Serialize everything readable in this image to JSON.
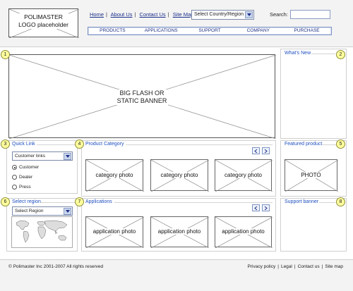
{
  "header": {
    "logo_text": "POLIMASTER\nLOGO  placeholder",
    "top_links": [
      "Home",
      "About Us",
      "Contact Us",
      "Site Map"
    ],
    "country_select": "Select Country/Region",
    "search_label": "Search:",
    "search_value": "",
    "nav": [
      "PRODUCTS",
      "APPLICATIONS",
      "SUPPORT",
      "COMPANY",
      "PURCHASE"
    ]
  },
  "banner": {
    "badge": "1",
    "label": "BIG FLASH OR\nSTATIC BANNER"
  },
  "whats_new": {
    "badge": "2",
    "title": "What's New"
  },
  "quick_link": {
    "badge": "3",
    "title": "Quick Link",
    "select_value": "Customer links",
    "options": [
      {
        "label": "Customer",
        "selected": true
      },
      {
        "label": "Dealer",
        "selected": false
      },
      {
        "label": "Press",
        "selected": false
      }
    ]
  },
  "product_category": {
    "badge": "4",
    "title": "Product Category",
    "prev": "<",
    "next": ">",
    "photos": [
      "category photo",
      "category photo",
      "category photo"
    ]
  },
  "featured_product": {
    "badge": "5",
    "title": "Featured product",
    "photo": "PHOTO"
  },
  "select_region": {
    "badge": "6",
    "title": "Select region",
    "select_value": "Select Region"
  },
  "applications": {
    "badge": "7",
    "title": "Applications",
    "prev": "<",
    "next": ">",
    "photos": [
      "application photo",
      "application photo",
      "application photo"
    ]
  },
  "support_banner": {
    "badge": "8",
    "title": "Support banner"
  },
  "footer": {
    "copyright": "© Polimaster Inc  2001-2007   All rights  reserved",
    "links": [
      "Privacy policy",
      "Legal",
      "Contact us",
      "Site map"
    ]
  },
  "colors": {
    "link_blue": "#1f4fbf",
    "nav_border": "#7d93c3",
    "badge_fill": "#ffff9e",
    "header_bg": "#f3f3f3"
  }
}
